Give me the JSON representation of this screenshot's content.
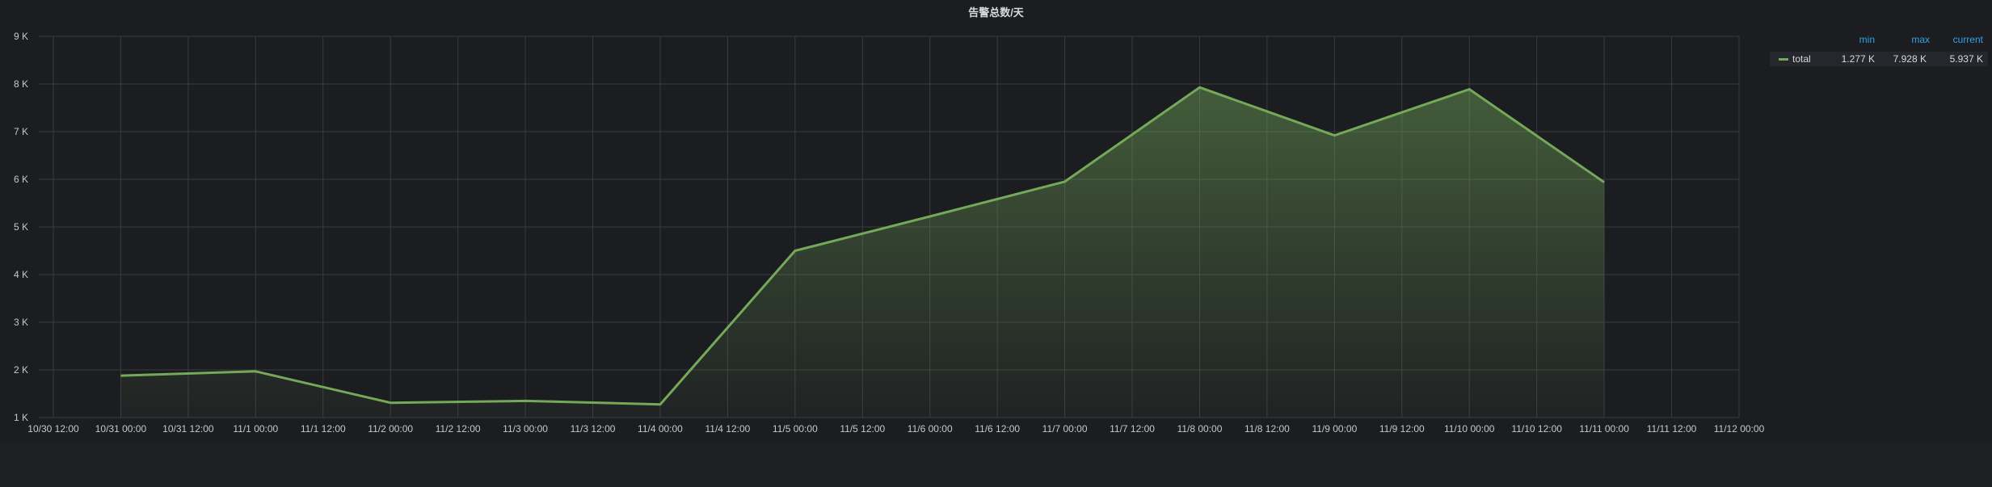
{
  "panel": {
    "title": "告警总数/天"
  },
  "legend": {
    "headers": {
      "min": "min",
      "max": "max",
      "current": "current"
    },
    "series": {
      "name": "total",
      "min": "1.277 K",
      "max": "7.928 K",
      "current": "5.937 K",
      "color": "#73a959"
    }
  },
  "chart_data": {
    "type": "area",
    "title": "告警总数/天",
    "xlabel": "",
    "ylabel": "",
    "x_ticks": [
      "10/30 12:00",
      "10/31 00:00",
      "10/31 12:00",
      "11/1 00:00",
      "11/1 12:00",
      "11/2 00:00",
      "11/2 12:00",
      "11/3 00:00",
      "11/3 12:00",
      "11/4 00:00",
      "11/4 12:00",
      "11/5 00:00",
      "11/5 12:00",
      "11/6 00:00",
      "11/6 12:00",
      "11/7 00:00",
      "11/7 12:00",
      "11/8 00:00",
      "11/8 12:00",
      "11/9 00:00",
      "11/9 12:00",
      "11/10 00:00",
      "11/10 12:00",
      "11/11 00:00",
      "11/11 12:00",
      "11/12 00:00"
    ],
    "y_ticks": [
      "1 K",
      "2 K",
      "3 K",
      "4 K",
      "5 K",
      "6 K",
      "7 K",
      "8 K",
      "9 K"
    ],
    "ylim": [
      1000,
      9000
    ],
    "xlim": [
      "10/30 12:00",
      "11/12 00:00"
    ],
    "grid": true,
    "legend_position": "right",
    "series": [
      {
        "name": "total",
        "color": "#73a959",
        "x": [
          "10/31 00:00",
          "11/1 00:00",
          "11/2 00:00",
          "11/3 00:00",
          "11/4 00:00",
          "11/5 00:00",
          "11/6 00:00",
          "11/7 00:00",
          "11/8 00:00",
          "11/9 00:00",
          "11/10 00:00",
          "11/11 00:00"
        ],
        "values": [
          1880,
          1970,
          1310,
          1350,
          1277,
          4500,
          5220,
          5950,
          7928,
          6920,
          7890,
          5937
        ]
      }
    ]
  }
}
